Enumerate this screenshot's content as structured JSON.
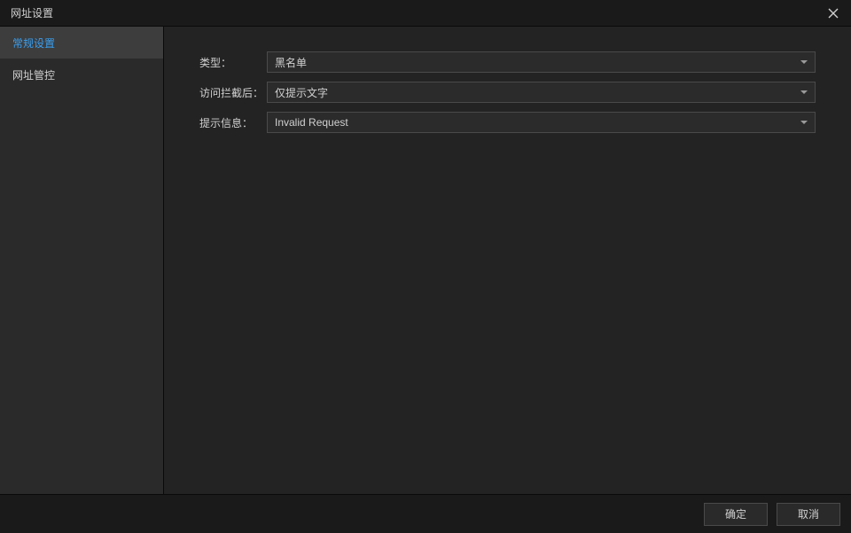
{
  "titlebar": {
    "title": "网址设置"
  },
  "sidebar": {
    "items": [
      {
        "label": "常规设置",
        "active": true
      },
      {
        "label": "网址管控",
        "active": false
      }
    ]
  },
  "form": {
    "type_label": "类型：",
    "type_value": "黑名单",
    "block_label": "访问拦截后：",
    "block_value": "仅提示文字",
    "hint_label": "提示信息：",
    "hint_value": "Invalid Request"
  },
  "footer": {
    "ok": "确定",
    "cancel": "取消"
  }
}
